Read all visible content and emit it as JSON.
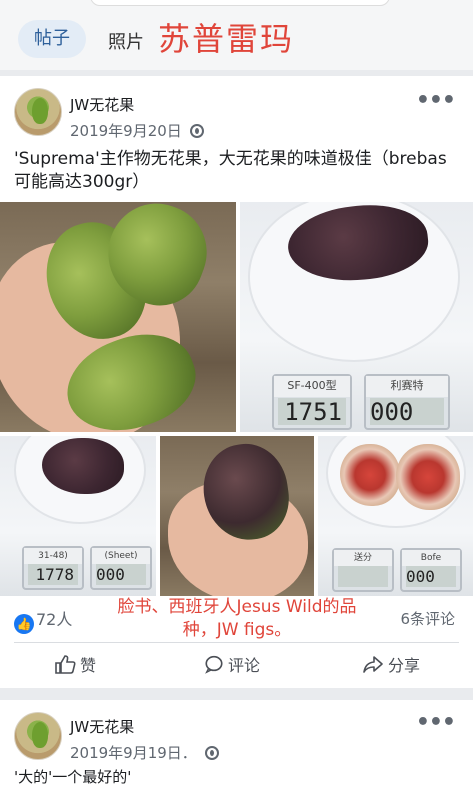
{
  "header": {
    "tab_posts": "帖子",
    "tab_photos": "照片",
    "title": "苏普雷玛"
  },
  "post1": {
    "author": "JW无花果",
    "date": "2019年9月20日",
    "text": "'Suprema'主作物无花果，大无花果的味道极佳（brebas可能高达300gr）",
    "scale1_label_left": "SF-400型",
    "scale1_label_right": "利赛特",
    "scale1_value_left": "1751",
    "scale1_value_right": "000",
    "scale2_label_left": "31-48)",
    "scale2_label_right": "(Sheet)",
    "scale2_value_left": "1778",
    "scale2_value_right": "000",
    "scale3_label_left": "送分",
    "scale3_label_right": "Bofe",
    "scale3_value_right": "000",
    "likes": "72人",
    "comments": "6条评论",
    "overlay_caption": "脸书、西班牙人Jesus Wild的品种，JW figs。",
    "actions": {
      "like": "赞",
      "comment": "评论",
      "share": "分享"
    }
  },
  "post2": {
    "author": "JW无花果",
    "date": "2019年9月19日．",
    "text": "'大的'一个最好的'"
  },
  "colors": {
    "title_red": "#e0453a",
    "like_blue": "#1877f2"
  }
}
